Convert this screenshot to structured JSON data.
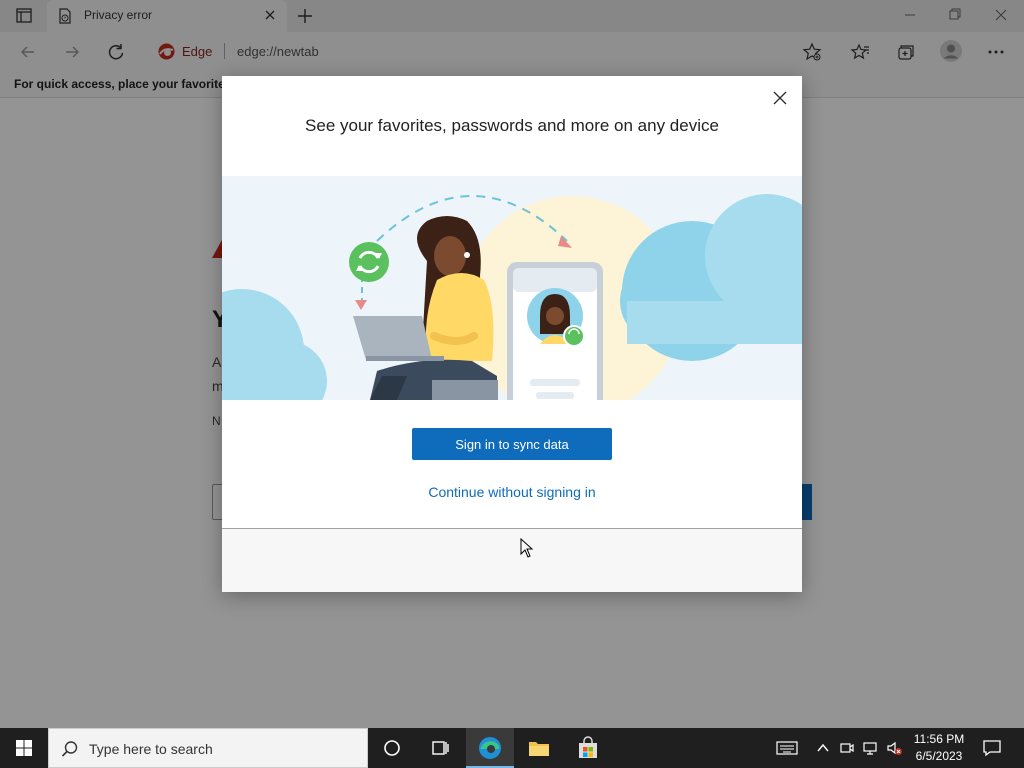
{
  "browser": {
    "tab_title": "Privacy error",
    "site_name": "Edge",
    "url": "edge://newtab",
    "favorites_bar_text": "For quick access, place your favorites here on the favorites bar."
  },
  "background_page": {
    "heading_initial": "Y",
    "line1_initial": "A",
    "line2_initial": "m",
    "line3_initial": "N"
  },
  "modal": {
    "title": "See your favorites, passwords and more on any device",
    "primary_button": "Sign in to sync data",
    "secondary_link": "Continue without signing in"
  },
  "taskbar": {
    "search_placeholder": "Type here to search",
    "time": "11:56 PM",
    "date": "6/5/2023"
  },
  "colors": {
    "accent": "#0f6cbd",
    "sync_green": "#5bc05e",
    "cloud_blue": "#8fd3ea",
    "shirt_yellow": "#ffd866"
  }
}
